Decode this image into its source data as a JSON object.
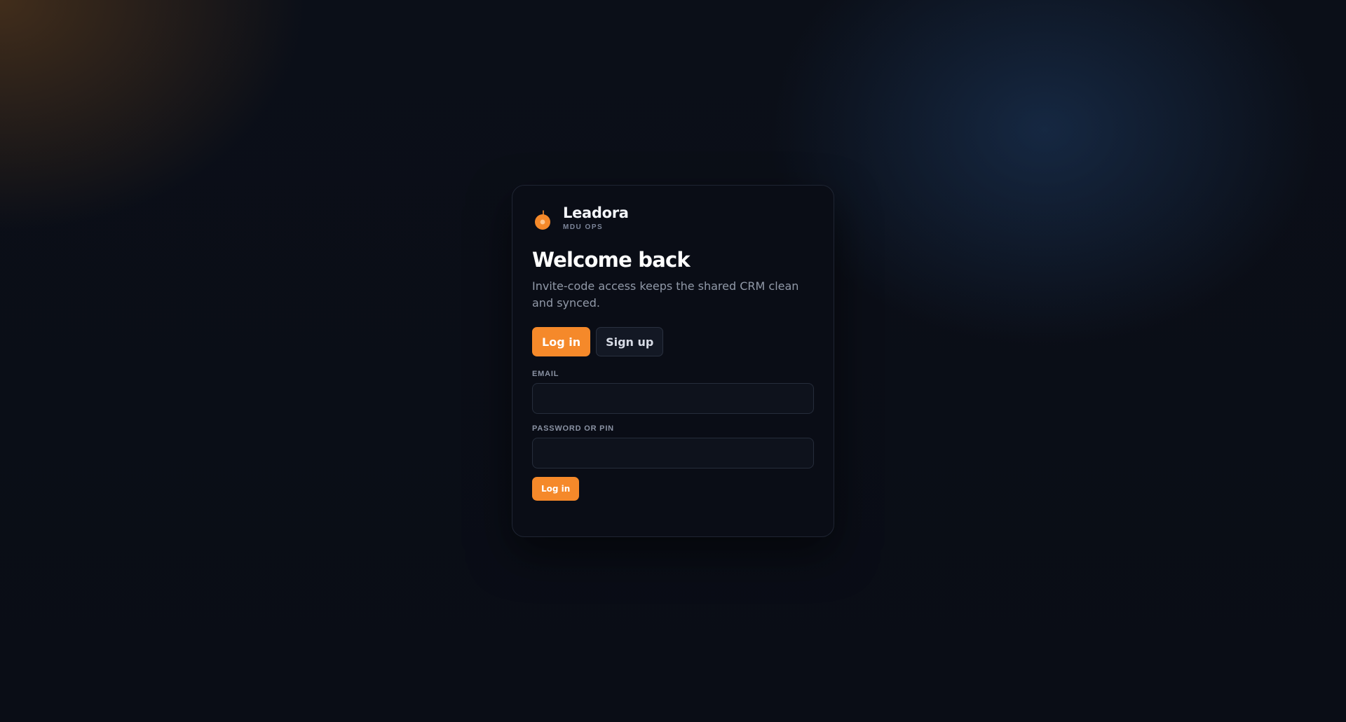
{
  "brand": {
    "name": "Leadora",
    "subtitle": "MDU OPS",
    "logo_icon": "orange-fruit-icon",
    "accent_color": "#f5892a"
  },
  "heading": {
    "title": "Welcome back",
    "subtitle": "Invite-code access keeps the shared CRM clean and synced."
  },
  "tabs": [
    {
      "label": "Log in",
      "active": true
    },
    {
      "label": "Sign up",
      "active": false
    }
  ],
  "form": {
    "email": {
      "label": "EMAIL",
      "value": "",
      "placeholder": ""
    },
    "password": {
      "label": "PASSWORD OR PIN",
      "value": "",
      "placeholder": ""
    },
    "submit_label": "Log in"
  }
}
